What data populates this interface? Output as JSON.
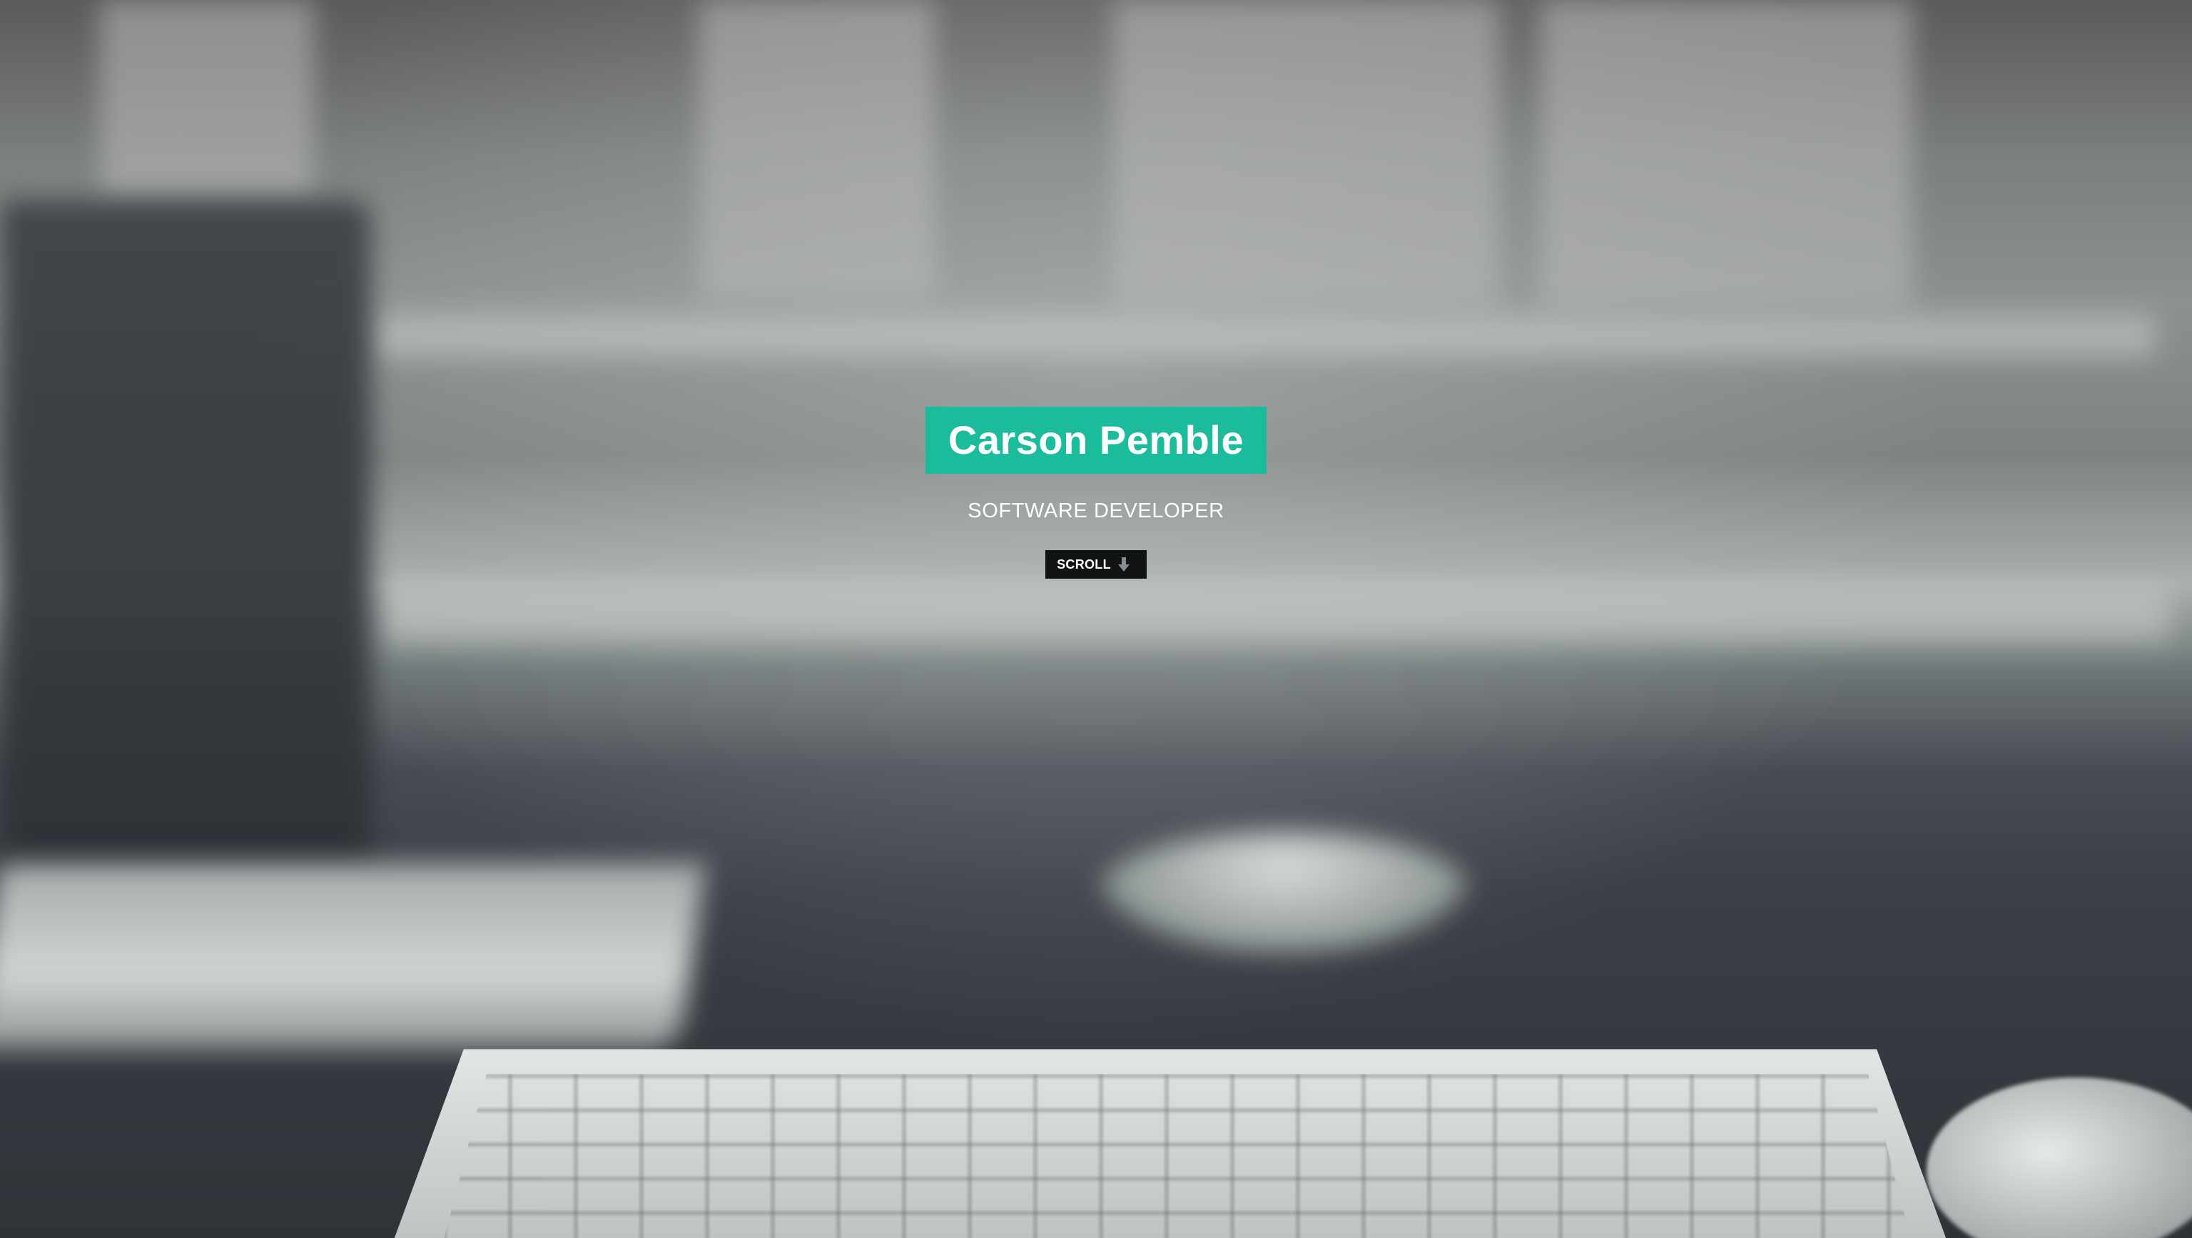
{
  "hero": {
    "name": "Carson Pemble",
    "title": "SOFTWARE DEVELOPER",
    "scroll_label": "SCROLL",
    "scroll_icon": "arrow-down-icon"
  },
  "colors": {
    "accent": "#1abc9c",
    "button_bg": "#111214",
    "text": "#ffffff"
  }
}
